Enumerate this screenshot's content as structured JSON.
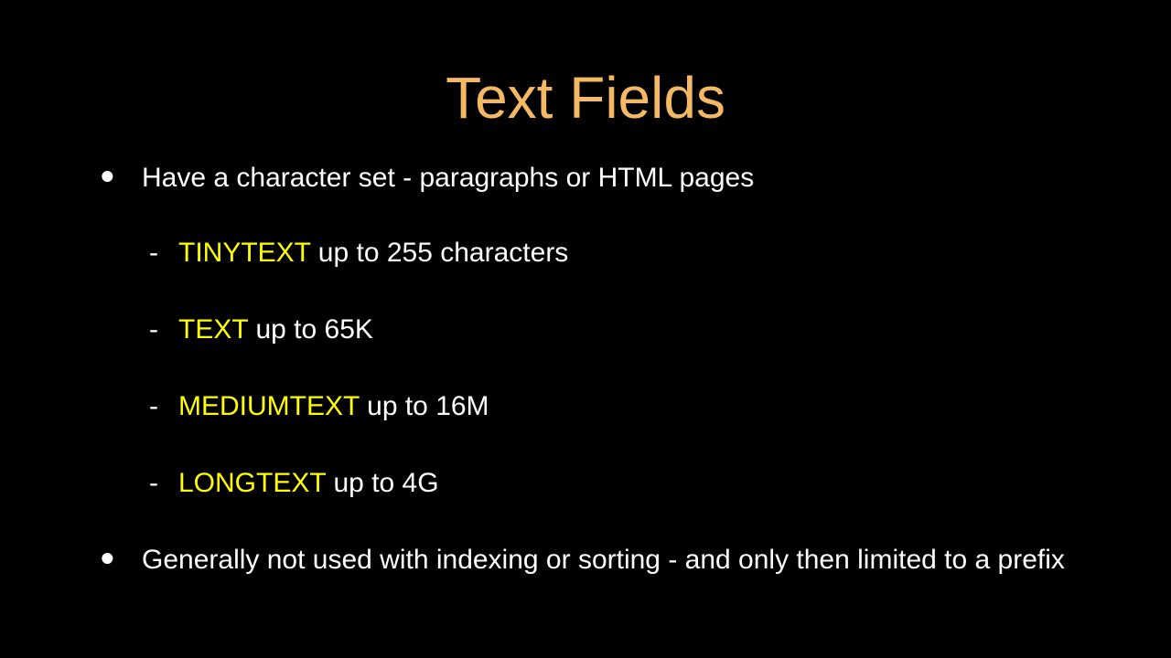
{
  "title": "Text Fields",
  "bullets": [
    {
      "text": "Have a character set - paragraphs or HTML pages",
      "subitems": [
        {
          "keyword": "TINYTEXT",
          "rest": " up to 255 characters"
        },
        {
          "keyword": "TEXT",
          "rest": " up to 65K"
        },
        {
          "keyword": "MEDIUMTEXT",
          "rest": " up to 16M"
        },
        {
          "keyword": "LONGTEXT",
          "rest": " up to 4G"
        }
      ]
    },
    {
      "text": "Generally not used with indexing or sorting - and only then limited to a prefix",
      "subitems": []
    }
  ]
}
